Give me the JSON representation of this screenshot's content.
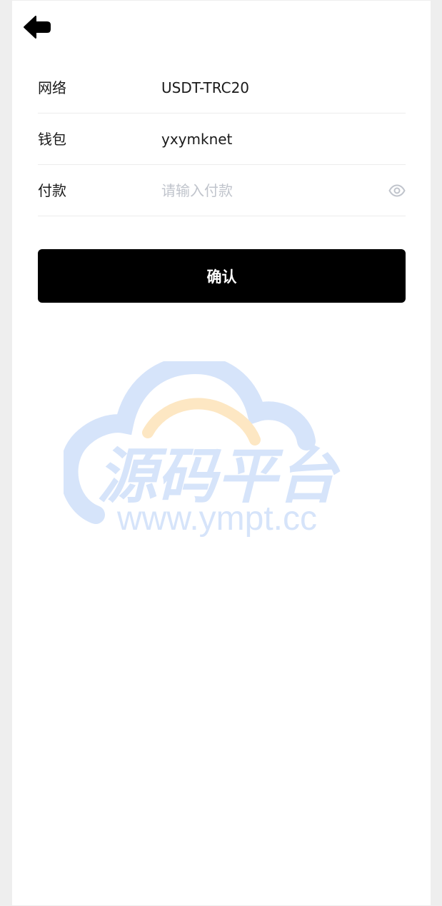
{
  "form": {
    "rows": [
      {
        "label": "网络",
        "value": "USDT-TRC20"
      },
      {
        "label": "钱包",
        "value": "yxymknet"
      },
      {
        "label": "付款",
        "value": "",
        "placeholder": "请输入付款"
      }
    ],
    "confirm_label": "确认"
  },
  "watermark": {
    "title": "源码平台",
    "url": "www.ympt.cc"
  },
  "icons": {
    "back": "arrow-left-icon",
    "eye": "eye-icon"
  },
  "colors": {
    "button_bg": "#000000",
    "button_text": "#ffffff",
    "placeholder": "#c0c4cc",
    "divider": "#ececec",
    "watermark_blue": "#d6e4fa",
    "watermark_orange": "#fde7c3"
  }
}
